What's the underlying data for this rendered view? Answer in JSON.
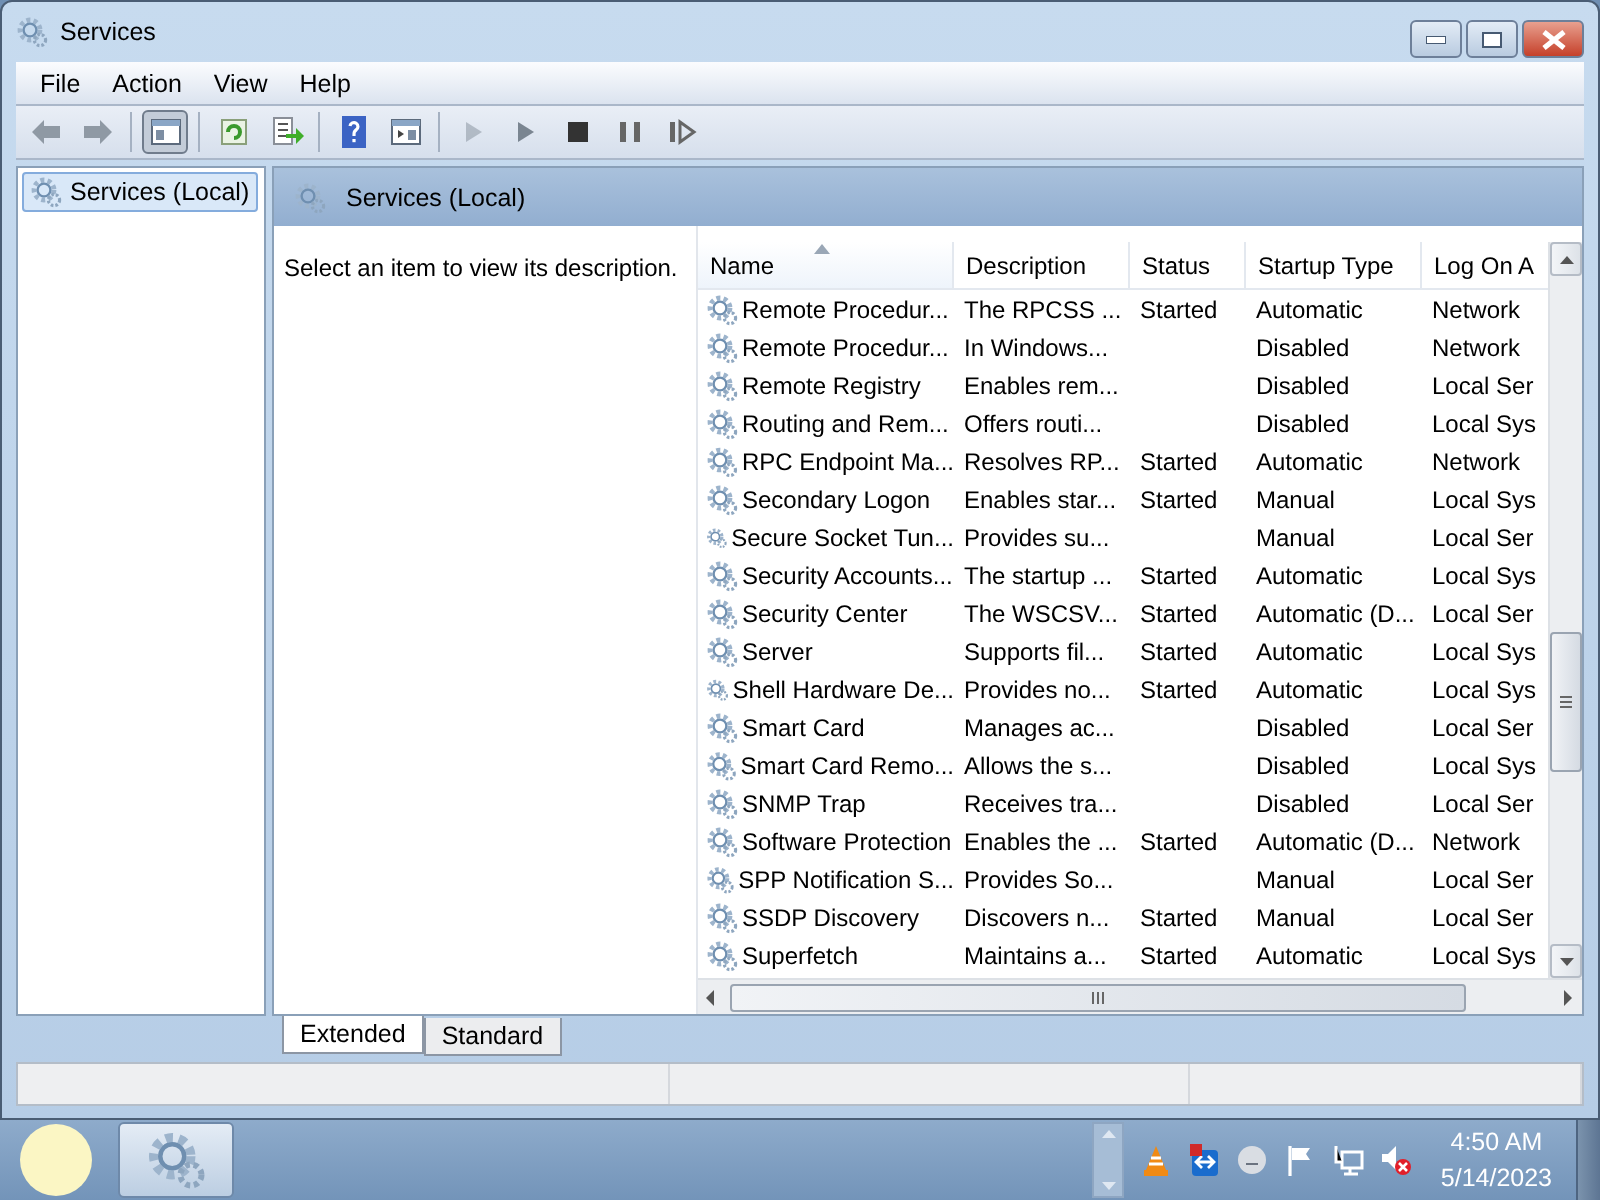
{
  "window": {
    "title": "Services"
  },
  "menu": [
    "File",
    "Action",
    "View",
    "Help"
  ],
  "toolbar": [
    {
      "kind": "back",
      "pressed": false,
      "disabled": false
    },
    {
      "kind": "forward",
      "pressed": false,
      "disabled": false
    },
    {
      "kind": "separator"
    },
    {
      "kind": "tree",
      "pressed": true,
      "disabled": false
    },
    {
      "kind": "separator"
    },
    {
      "kind": "refresh",
      "pressed": false,
      "disabled": false
    },
    {
      "kind": "export",
      "pressed": false,
      "disabled": false
    },
    {
      "kind": "separator"
    },
    {
      "kind": "help",
      "pressed": false,
      "disabled": false
    },
    {
      "kind": "properties",
      "pressed": false,
      "disabled": false
    },
    {
      "kind": "separator"
    },
    {
      "kind": "play",
      "pressed": false,
      "disabled": true
    },
    {
      "kind": "play",
      "pressed": false,
      "disabled": false
    },
    {
      "kind": "stop",
      "pressed": false,
      "disabled": false
    },
    {
      "kind": "pause",
      "pressed": false,
      "disabled": false
    },
    {
      "kind": "resume",
      "pressed": false,
      "disabled": false
    }
  ],
  "tree": [
    {
      "label": "Services (Local)",
      "selected": true
    }
  ],
  "panel": {
    "title": "Services (Local)",
    "description_prompt": "Select an item to view its description."
  },
  "table": {
    "columns": [
      {
        "label": "Name",
        "sorted": true
      },
      {
        "label": "Description",
        "sorted": false
      },
      {
        "label": "Status",
        "sorted": false
      },
      {
        "label": "Startup Type",
        "sorted": false
      },
      {
        "label": "Log On A",
        "sorted": false
      }
    ],
    "rows": [
      {
        "name": "Remote Procedur...",
        "description": "The RPCSS ...",
        "status": "Started",
        "startup_type": "Automatic",
        "log_on_as": "Network"
      },
      {
        "name": "Remote Procedur...",
        "description": "In Windows...",
        "status": "",
        "startup_type": "Disabled",
        "log_on_as": "Network"
      },
      {
        "name": "Remote Registry",
        "description": "Enables rem...",
        "status": "",
        "startup_type": "Disabled",
        "log_on_as": "Local Ser"
      },
      {
        "name": "Routing and Rem...",
        "description": "Offers routi...",
        "status": "",
        "startup_type": "Disabled",
        "log_on_as": "Local Sys"
      },
      {
        "name": "RPC Endpoint Ma...",
        "description": "Resolves RP...",
        "status": "Started",
        "startup_type": "Automatic",
        "log_on_as": "Network"
      },
      {
        "name": "Secondary Logon",
        "description": "Enables star...",
        "status": "Started",
        "startup_type": "Manual",
        "log_on_as": "Local Sys"
      },
      {
        "name": "Secure Socket Tun...",
        "description": "Provides su...",
        "status": "",
        "startup_type": "Manual",
        "log_on_as": "Local Ser"
      },
      {
        "name": "Security Accounts...",
        "description": "The startup ...",
        "status": "Started",
        "startup_type": "Automatic",
        "log_on_as": "Local Sys"
      },
      {
        "name": "Security Center",
        "description": "The WSCSV...",
        "status": "Started",
        "startup_type": "Automatic (D...",
        "log_on_as": "Local Ser"
      },
      {
        "name": "Server",
        "description": "Supports fil...",
        "status": "Started",
        "startup_type": "Automatic",
        "log_on_as": "Local Sys"
      },
      {
        "name": "Shell Hardware De...",
        "description": "Provides no...",
        "status": "Started",
        "startup_type": "Automatic",
        "log_on_as": "Local Sys"
      },
      {
        "name": "Smart Card",
        "description": "Manages ac...",
        "status": "",
        "startup_type": "Disabled",
        "log_on_as": "Local Ser"
      },
      {
        "name": "Smart Card Remo...",
        "description": "Allows the s...",
        "status": "",
        "startup_type": "Disabled",
        "log_on_as": "Local Sys"
      },
      {
        "name": "SNMP Trap",
        "description": "Receives tra...",
        "status": "",
        "startup_type": "Disabled",
        "log_on_as": "Local Ser"
      },
      {
        "name": "Software Protection",
        "description": "Enables the ...",
        "status": "Started",
        "startup_type": "Automatic (D...",
        "log_on_as": "Network"
      },
      {
        "name": "SPP Notification S...",
        "description": "Provides So...",
        "status": "",
        "startup_type": "Manual",
        "log_on_as": "Local Ser"
      },
      {
        "name": "SSDP Discovery",
        "description": "Discovers n...",
        "status": "Started",
        "startup_type": "Manual",
        "log_on_as": "Local Ser"
      },
      {
        "name": "Superfetch",
        "description": "Maintains a...",
        "status": "Started",
        "startup_type": "Automatic",
        "log_on_as": "Local Sys"
      }
    ]
  },
  "view_tabs": [
    {
      "label": "Extended",
      "selected": true
    },
    {
      "label": "Standard",
      "selected": false
    }
  ],
  "taskbar": {
    "buttons": [
      {
        "kind": "services",
        "active": true
      }
    ],
    "time": "4:50 AM",
    "date": "5/14/2023"
  }
}
